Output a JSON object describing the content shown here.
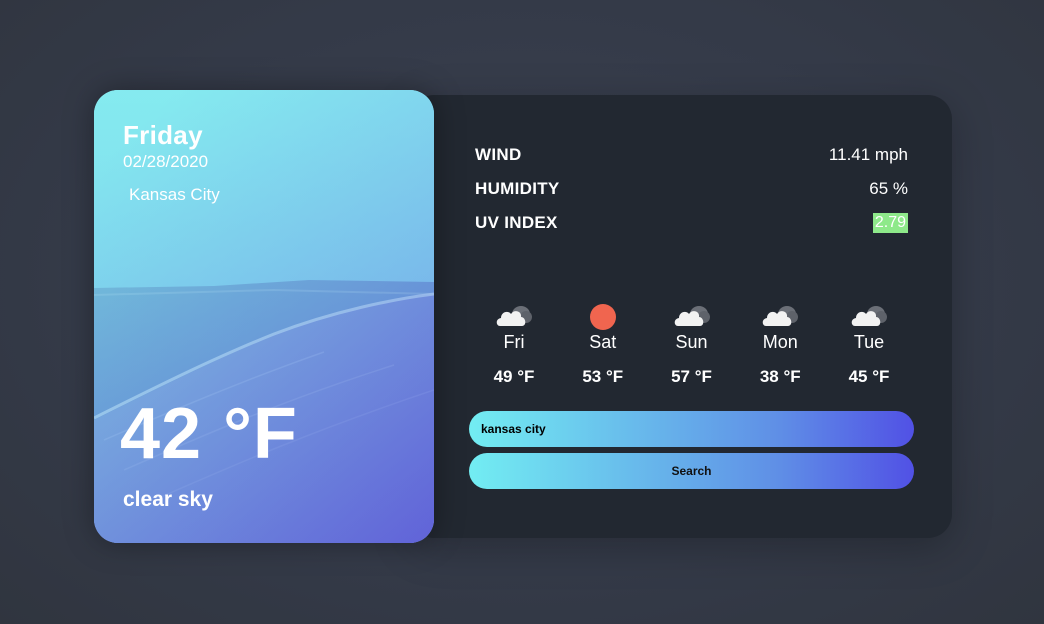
{
  "current": {
    "day": "Friday",
    "date": "02/28/2020",
    "location": "Kansas City",
    "temperature": "42 °F",
    "description": "clear sky"
  },
  "stats": [
    {
      "label": "WIND",
      "value": "11.41 mph"
    },
    {
      "label": "HUMIDITY",
      "value": "65 %"
    },
    {
      "label": "UV INDEX",
      "value": "2.79",
      "color": "#8ee98a"
    }
  ],
  "forecast": [
    {
      "day": "Fri",
      "temp": "49 °F",
      "icon": "cloud-icon"
    },
    {
      "day": "Sat",
      "temp": "53 °F",
      "icon": "sun-icon"
    },
    {
      "day": "Sun",
      "temp": "57 °F",
      "icon": "cloud-icon"
    },
    {
      "day": "Mon",
      "temp": "38 °F",
      "icon": "cloud-icon"
    },
    {
      "day": "Tue",
      "temp": "45 °F",
      "icon": "cloud-icon"
    }
  ],
  "search": {
    "value": "kansas city",
    "button_label": "Search"
  },
  "colors": {
    "gradient_start": "#72edf2",
    "gradient_end": "#5151e5",
    "panel_bg": "#222831",
    "page_bg": "#343a48",
    "sun": "#f0654f"
  }
}
